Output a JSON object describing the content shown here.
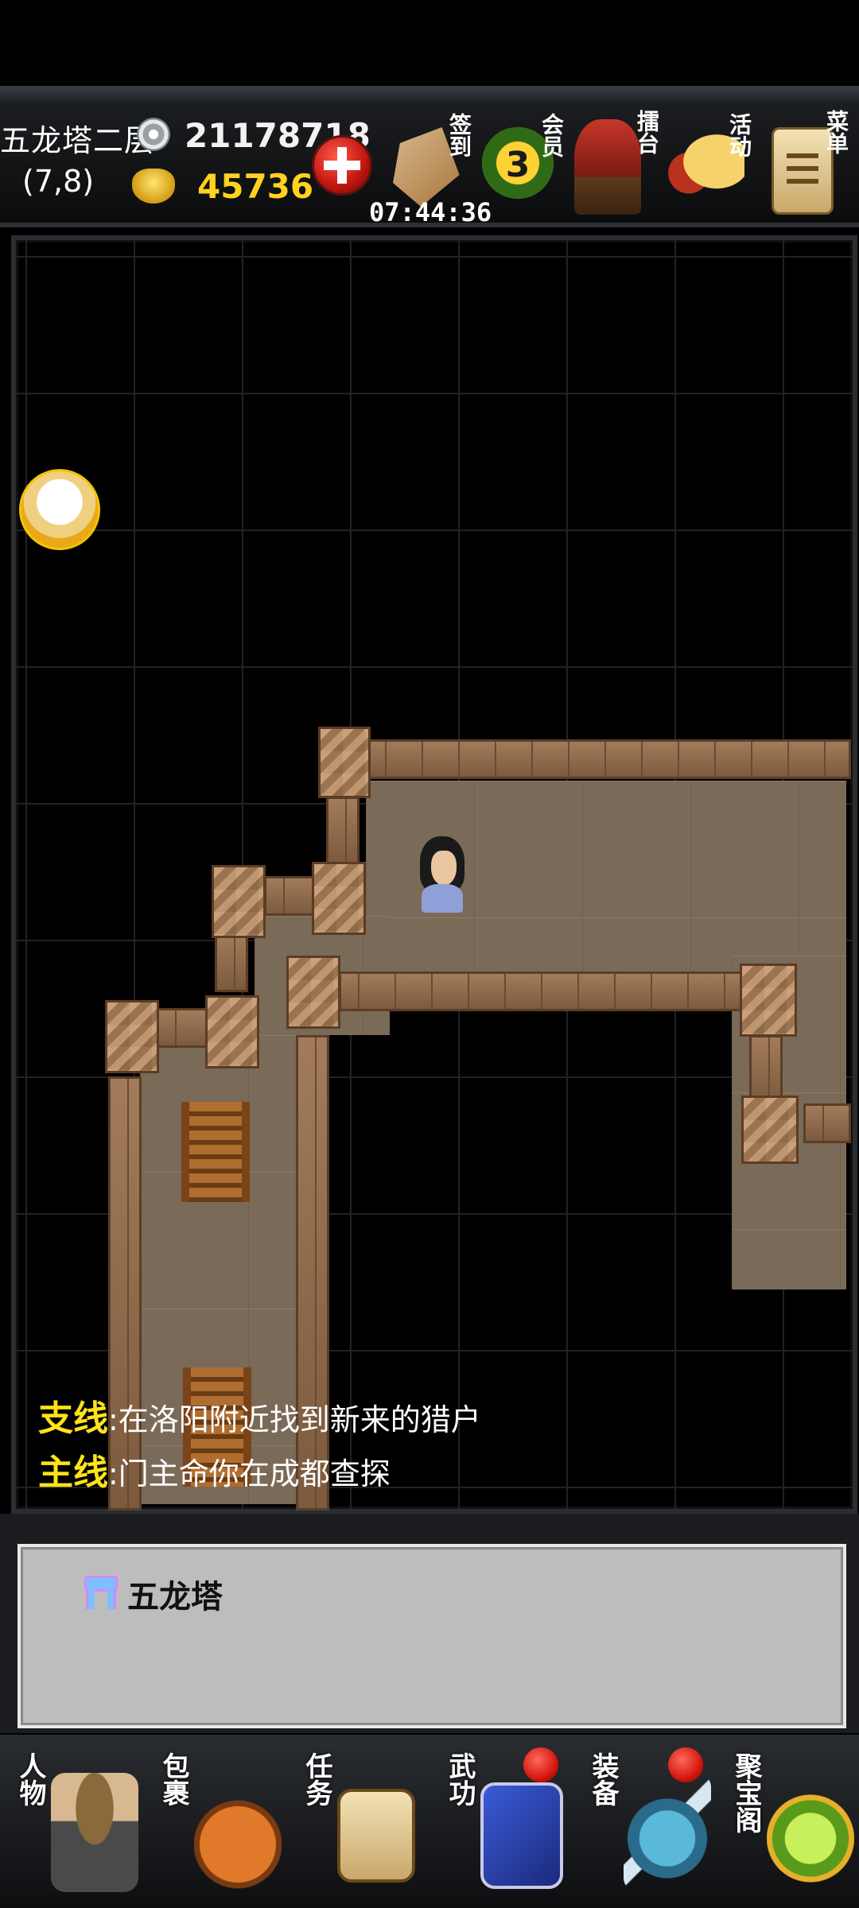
{
  "status": {
    "location_name": "五龙塔二层",
    "coordinates": "(7,8)",
    "silver": "21178718",
    "gold": "45736",
    "timer": "07:44:36"
  },
  "top_menu": {
    "signin": "签到",
    "vip": "会员",
    "vip_level": "3",
    "arena": "擂台",
    "activity": "活动",
    "menu": "菜单"
  },
  "quests": {
    "side_tag": "支线",
    "side_text": ":在洛阳附近找到新来的猎户",
    "main_tag": "主线",
    "main_text": ":门主命你在成都查探"
  },
  "info_panel": {
    "title": "五龙塔"
  },
  "bottom_nav": [
    {
      "label": "人物",
      "icon": "character-icon",
      "badge": false
    },
    {
      "label": "包裹",
      "icon": "bag-icon",
      "badge": false
    },
    {
      "label": "任务",
      "icon": "task-scroll-icon",
      "badge": false
    },
    {
      "label": "武功",
      "icon": "martial-book-icon",
      "badge": true
    },
    {
      "label": "装备",
      "icon": "equipment-icon",
      "badge": true
    },
    {
      "label": "聚宝阁",
      "icon": "treasure-shop-icon",
      "badge": false
    }
  ],
  "colors": {
    "gold_text": "#ffd21f",
    "quest_tag": "#ffe21a",
    "panel_bg": "#bdbdbd",
    "badge_red": "#d0120a"
  }
}
